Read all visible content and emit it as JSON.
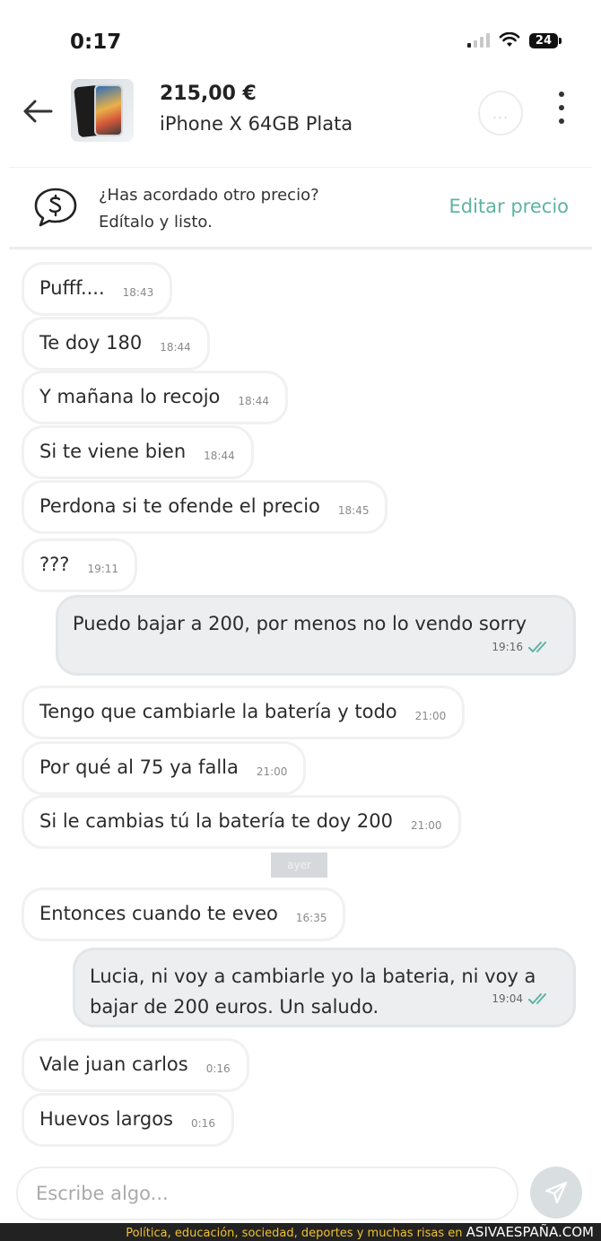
{
  "status_bar": {
    "time": "0:17",
    "battery": "24"
  },
  "header": {
    "price": "215,00 €",
    "product_title": "iPhone X 64GB Plata",
    "more_label": "..."
  },
  "price_banner": {
    "question": "¿Has acordado otro precio?",
    "subtitle": "Edítalo y listo.",
    "action_label": "Editar precio",
    "accent_color": "#5db3a2"
  },
  "messages": [
    {
      "direction": "in",
      "text": "Pufff....",
      "time": "18:43"
    },
    {
      "direction": "in",
      "text": "Te doy 180",
      "time": "18:44"
    },
    {
      "direction": "in",
      "text": "Y mañana lo recojo",
      "time": "18:44"
    },
    {
      "direction": "in",
      "text": "Si te viene bien",
      "time": "18:44"
    },
    {
      "direction": "in",
      "text": "Perdona si te ofende el precio",
      "time": "18:45"
    },
    {
      "direction": "in",
      "text": "???",
      "time": "19:11"
    },
    {
      "direction": "out",
      "text": "Puedo bajar a 200, por menos no lo vendo sorry",
      "time": "19:16",
      "status": "read"
    },
    {
      "direction": "in",
      "text": "Tengo que cambiarle la batería y todo",
      "time": "21:00"
    },
    {
      "direction": "in",
      "text": "Por qué al 75 ya falla",
      "time": "21:00"
    },
    {
      "direction": "in",
      "text": "Si le cambias tú la batería te doy 200",
      "time": "21:00"
    },
    {
      "direction": "in",
      "text": "Entonces cuando te eveo",
      "time": "16:35"
    },
    {
      "direction": "out",
      "text": "Lucia, ni voy a cambiarle yo la bateria, ni voy a bajar de 200 euros. Un saludo.",
      "time": "19:04",
      "status": "read"
    },
    {
      "direction": "in",
      "text": "Vale juan carlos",
      "time": "0:16"
    },
    {
      "direction": "in",
      "text": "Huevos largos",
      "time": "0:16"
    }
  ],
  "day_separator": "ayer",
  "composer": {
    "placeholder": "Escribe algo..."
  },
  "footer": {
    "tagline": "Política, educación, sociedad, deportes y muchas risas en",
    "brand": "ASIVAESPAÑA.COM"
  },
  "icons": {
    "back": "arrow-left-icon",
    "menu": "kebab-menu-icon",
    "banner": "price-chat-icon",
    "read_receipt": "double-check-icon",
    "send": "send-icon"
  },
  "colors": {
    "read_check": "#5db3a2",
    "separator": "#d6d9db",
    "footer_text": "#f2c12e"
  }
}
